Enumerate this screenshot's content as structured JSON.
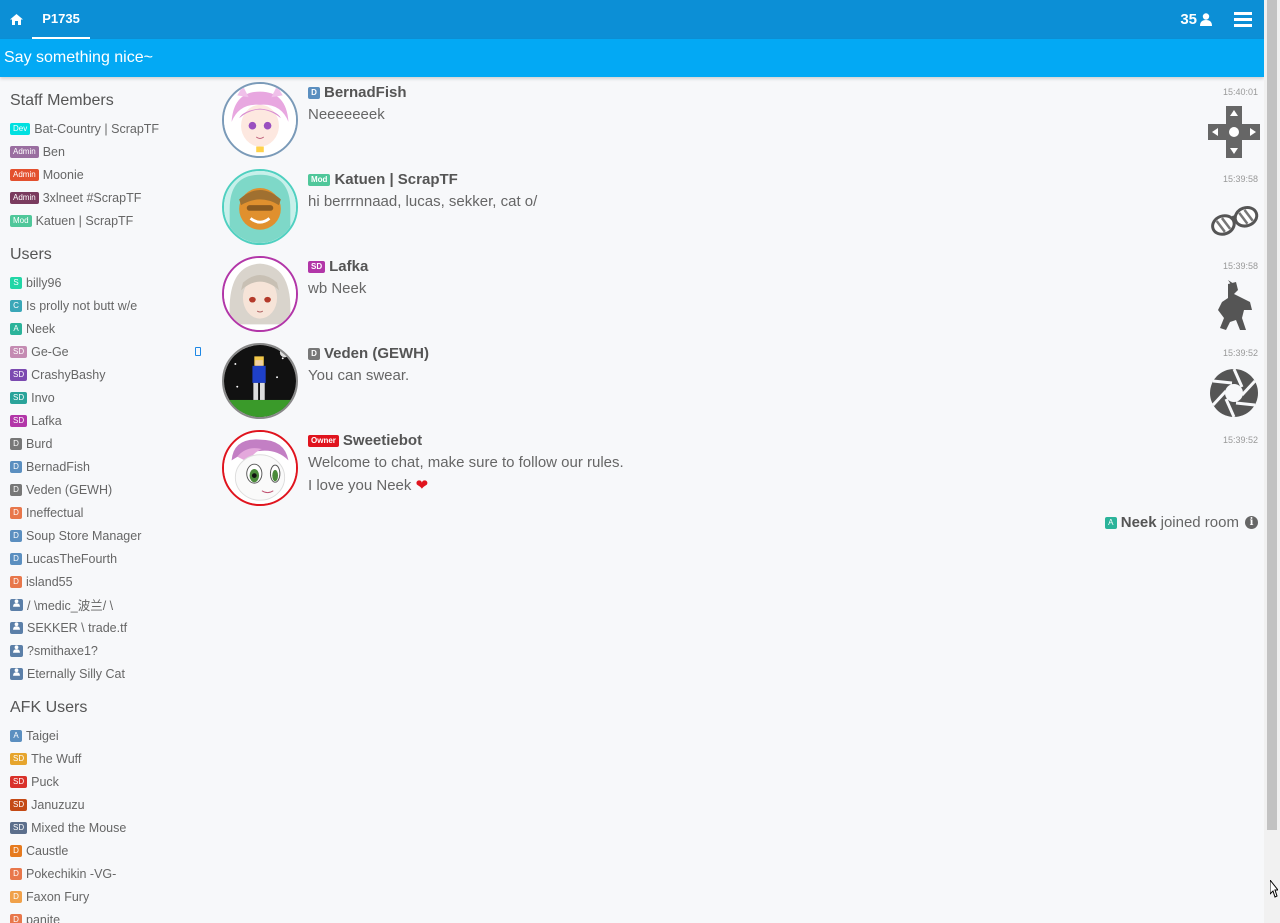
{
  "topbar": {
    "home_icon": "home-icon",
    "room": "P1735",
    "user_count": "35",
    "user_icon": "user-icon",
    "menu_icon": "hamburger-icon"
  },
  "topic": "Say something nice~",
  "sections": {
    "staff": "Staff Members",
    "users": "Users",
    "afk": "AFK Users"
  },
  "staff": [
    {
      "badge": "Dev",
      "color": "#00e0e0",
      "name": "Bat-Country | ScrapTF"
    },
    {
      "badge": "Admin",
      "color": "#9a6ea0",
      "name": "Ben"
    },
    {
      "badge": "Admin",
      "color": "#e3502e",
      "name": "Moonie"
    },
    {
      "badge": "Admin",
      "color": "#7a3b5e",
      "name": "3xlneet #ScrapTF"
    },
    {
      "badge": "Mod",
      "color": "#4fc79a",
      "name": "Katuen | ScrapTF"
    }
  ],
  "users": [
    {
      "badge": "S",
      "color": "#21d6a6",
      "name": "billy96"
    },
    {
      "badge": "C",
      "color": "#3aa7b8",
      "name": "Is prolly not butt w/e"
    },
    {
      "badge": "A",
      "color": "#2bb39a",
      "name": "Neek"
    },
    {
      "badge": "SD",
      "color": "#c48bb2",
      "name": "Ge-Ge"
    },
    {
      "badge": "SD",
      "color": "#7b4ab0",
      "name": "CrashyBashy"
    },
    {
      "badge": "SD",
      "color": "#2aa39a",
      "name": "Invo"
    },
    {
      "badge": "SD",
      "color": "#b236a8",
      "name": "Lafka"
    },
    {
      "badge": "D",
      "color": "#777777",
      "name": "Burd"
    },
    {
      "badge": "D",
      "color": "#5b8fc0",
      "name": "BernadFish"
    },
    {
      "badge": "D",
      "color": "#777777",
      "name": "Veden (GEWH)"
    },
    {
      "badge": "D",
      "color": "#e8774b",
      "name": "Ineffectual"
    },
    {
      "badge": "D",
      "color": "#5b8fc0",
      "name": "Soup Store Manager"
    },
    {
      "badge": "D",
      "color": "#5b8fc0",
      "name": "LucasTheFourth"
    },
    {
      "badge": "D",
      "color": "#e8774b",
      "name": "island55"
    },
    {
      "badge": "user",
      "color": "#5b7fa8",
      "name": "/ \\medic_波兰/ \\"
    },
    {
      "badge": "user",
      "color": "#5b7fa8",
      "name": "SEKKER \\ trade.tf"
    },
    {
      "badge": "user",
      "color": "#5b7fa8",
      "name": "?smithaxe1?"
    },
    {
      "badge": "user",
      "color": "#5b7fa8",
      "name": "Eternally Silly Cat"
    }
  ],
  "afk": [
    {
      "badge": "A",
      "color": "#5b8fc0",
      "name": "Taigei"
    },
    {
      "badge": "SD",
      "color": "#e6a52e",
      "name": "The Wuff"
    },
    {
      "badge": "SD",
      "color": "#d9312a",
      "name": "Puck"
    },
    {
      "badge": "SD",
      "color": "#c44a15",
      "name": "Januzuzu"
    },
    {
      "badge": "SD",
      "color": "#5c6f8c",
      "name": "Mixed the Mouse"
    },
    {
      "badge": "D",
      "color": "#e67a1e",
      "name": "Caustle"
    },
    {
      "badge": "D",
      "color": "#e8774b",
      "name": "Pokechikin -VG-"
    },
    {
      "badge": "D",
      "color": "#f0a14a",
      "name": "Faxon Fury"
    },
    {
      "badge": "D",
      "color": "#e8774b",
      "name": "panite"
    }
  ],
  "messages": [
    {
      "badge": "D",
      "color": "#5b8fc0",
      "name": "BernadFish",
      "lines": [
        "Neeeeeeek"
      ],
      "time": "15:40:01",
      "flair": "dpad-icon",
      "border": "#7a9ab8"
    },
    {
      "badge": "Mod",
      "color": "#4fc79a",
      "name": "Katuen | ScrapTF",
      "lines": [
        "hi berrrnnaad, lucas, sekker, cat o/"
      ],
      "time": "15:39:58",
      "flair": "sunglasses-icon",
      "border": "#4fd0c0"
    },
    {
      "badge": "SD",
      "color": "#b236a8",
      "name": "Lafka",
      "lines": [
        "wb Neek"
      ],
      "time": "15:39:58",
      "flair": "horse-rider-icon",
      "border": "#b236a8"
    },
    {
      "badge": "D",
      "color": "#777777",
      "name": "Veden (GEWH)",
      "lines": [
        "You can swear."
      ],
      "time": "15:39:52",
      "flair": "aperture-icon",
      "border": "#888888"
    },
    {
      "badge": "Owner",
      "color": "#e0141e",
      "name": "Sweetiebot",
      "lines": [
        "Welcome to chat, make sure to follow our rules.",
        "I love you Neek ❤"
      ],
      "time": "15:39:52",
      "flair": "",
      "border": "#e0141e"
    }
  ],
  "joined": {
    "badge": "A",
    "color": "#2bb39a",
    "name": "Neek",
    "text": "joined room",
    "icon": "info-icon"
  }
}
